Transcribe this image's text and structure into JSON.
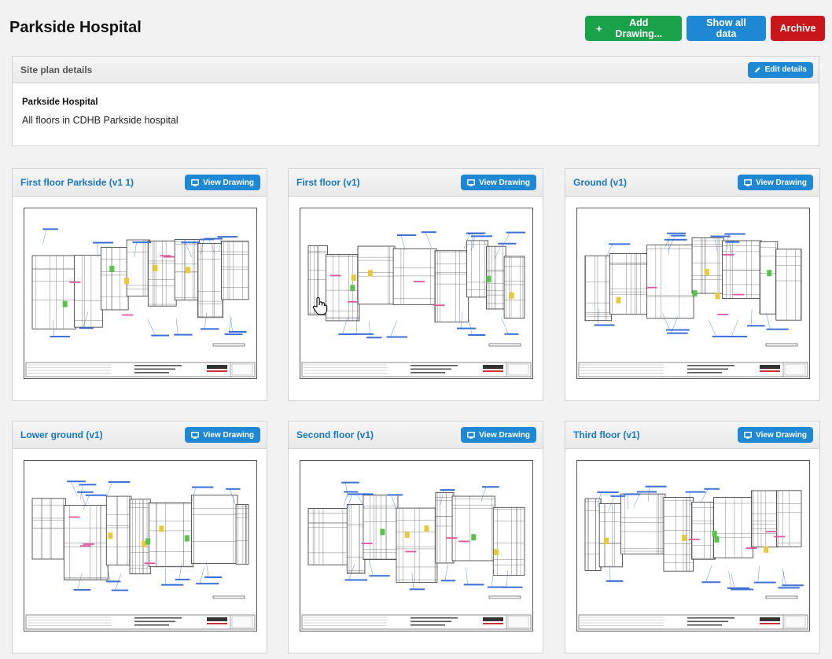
{
  "page": {
    "title": "Parkside Hospital"
  },
  "actions": {
    "add_drawing": "Add Drawing...",
    "show_all_data": "Show all data",
    "archive": "Archive"
  },
  "details": {
    "header": "Site plan details",
    "edit_label": "Edit details",
    "name": "Parkside Hospital",
    "description": "All floors in CDHB Parkside hospital"
  },
  "drawings": [
    {
      "title": "First floor Parkside (v1 1)",
      "button": "View Drawing"
    },
    {
      "title": "First floor (v1)",
      "button": "View Drawing"
    },
    {
      "title": "Ground (v1)",
      "button": "View Drawing"
    },
    {
      "title": "Lower ground (v1)",
      "button": "View Drawing"
    },
    {
      "title": "Second floor (v1)",
      "button": "View Drawing"
    },
    {
      "title": "Third floor (v1)",
      "button": "View Drawing"
    }
  ],
  "icons": {
    "add": "plus-icon",
    "edit": "pencil-icon",
    "view": "monitor-icon",
    "cursor": "hand-pointer-icon"
  },
  "colors": {
    "green": "#1aa24a",
    "blue": "#1e88d4",
    "red": "#c8161b",
    "link": "#1877c4"
  }
}
